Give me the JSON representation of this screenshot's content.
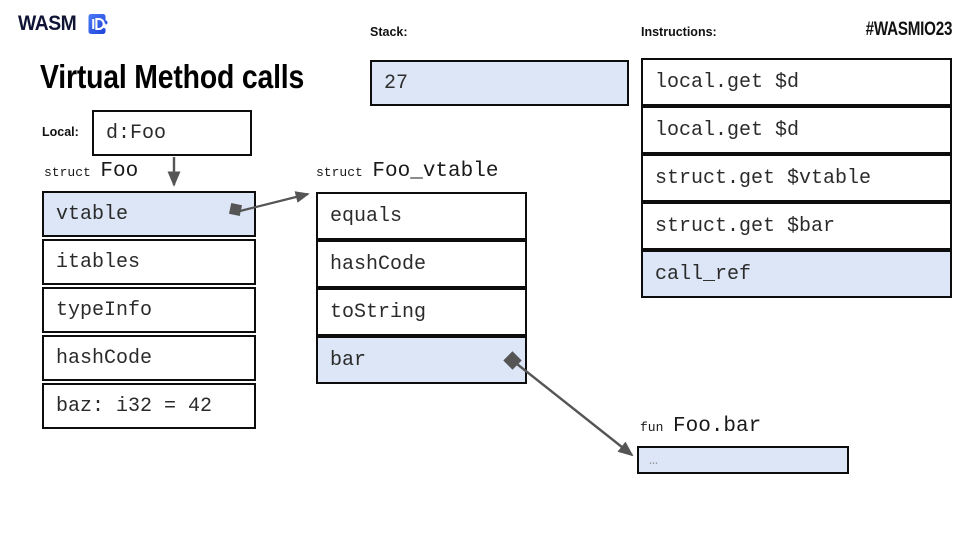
{
  "brand": {
    "word": "WASM",
    "mark_icon": "wasmio-puzzle-icon"
  },
  "header": {
    "title": "Virtual Method calls",
    "hashtag": "#WASMIO23"
  },
  "local": {
    "label": "Local:",
    "value": "d:Foo"
  },
  "foo_struct": {
    "caption_keyword": "struct",
    "caption_name": "Foo",
    "fields": [
      {
        "text": "vtable",
        "highlighted": true
      },
      {
        "text": "itables",
        "highlighted": false
      },
      {
        "text": "typeInfo",
        "highlighted": false
      },
      {
        "text": "hashCode",
        "highlighted": false
      },
      {
        "text": "baz: i32 = 42",
        "highlighted": false
      }
    ]
  },
  "foo_vtable": {
    "caption_keyword": "struct",
    "caption_name": "Foo_vtable",
    "fields": [
      {
        "text": "equals",
        "highlighted": false
      },
      {
        "text": "hashCode",
        "highlighted": false
      },
      {
        "text": "toString",
        "highlighted": false
      },
      {
        "text": "bar",
        "highlighted": true
      }
    ]
  },
  "stack": {
    "label": "Stack:",
    "entries": [
      {
        "text": "27",
        "highlighted": true
      }
    ]
  },
  "instructions": {
    "label": "Instructions:",
    "entries": [
      {
        "text": "local.get $d",
        "highlighted": false
      },
      {
        "text": "local.get $d",
        "highlighted": false
      },
      {
        "text": "struct.get $vtable",
        "highlighted": false
      },
      {
        "text": "struct.get $bar",
        "highlighted": false
      },
      {
        "text": "call_ref",
        "highlighted": true
      }
    ]
  },
  "function_body": {
    "caption_keyword": "fun",
    "caption_name": "Foo.bar",
    "body": "…",
    "highlighted": true
  },
  "colors": {
    "highlight": "#dce6f6",
    "border": "#0d0d0d",
    "arrow": "#555555",
    "brand_blue": "#2b6cf6",
    "text": "#2b2b2b"
  }
}
